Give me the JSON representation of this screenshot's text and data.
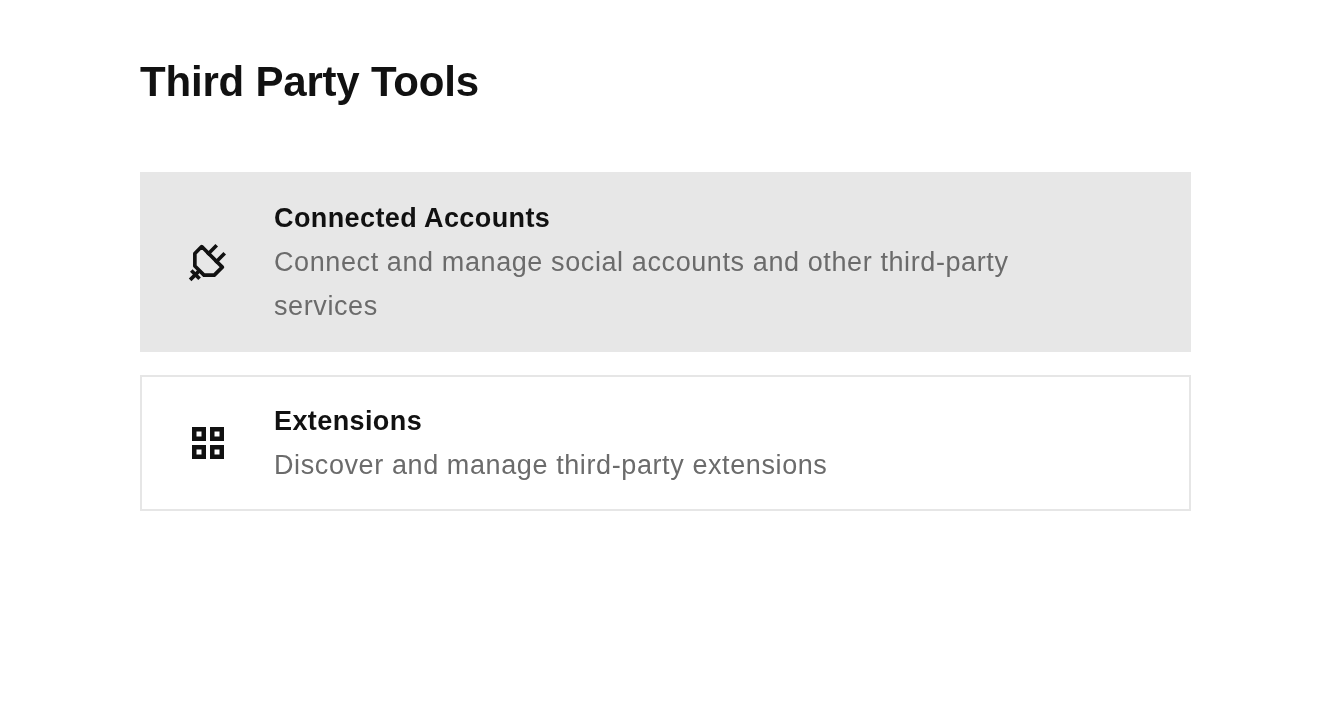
{
  "page": {
    "title": "Third Party Tools"
  },
  "items": [
    {
      "title": "Connected Accounts",
      "description": "Connect and manage social accounts and other third-party services",
      "selected": true
    },
    {
      "title": "Extensions",
      "description": "Discover and manage third-party extensions",
      "selected": false
    }
  ]
}
